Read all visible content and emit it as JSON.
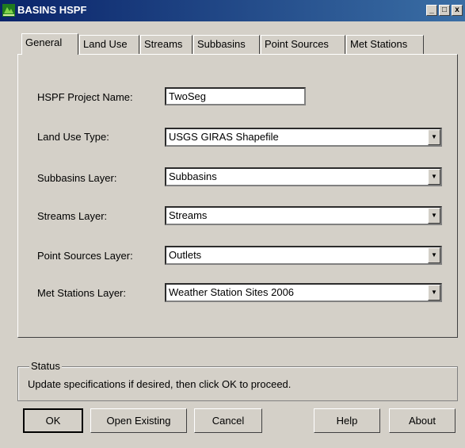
{
  "window": {
    "title": "BASINS HSPF"
  },
  "titlebar_buttons": {
    "minimize": "_",
    "maximize": "□",
    "close": "x"
  },
  "tabs": [
    "General",
    "Land Use",
    "Streams",
    "Subbasins",
    "Point Sources",
    "Met Stations"
  ],
  "active_tab": "General",
  "form": {
    "project_name": {
      "label": "HSPF Project Name:",
      "value": "TwoSeg"
    },
    "land_use_type": {
      "label": "Land Use Type:",
      "value": "USGS GIRAS Shapefile"
    },
    "subbasins_layer": {
      "label": "Subbasins Layer:",
      "value": "Subbasins"
    },
    "streams_layer": {
      "label": "Streams Layer:",
      "value": "Streams"
    },
    "point_sources_layer": {
      "label": "Point Sources Layer:",
      "value": "Outlets"
    },
    "met_stations_layer": {
      "label": "Met Stations Layer:",
      "value": "Weather Station Sites 2006"
    }
  },
  "status": {
    "caption": "Status",
    "message": "Update specifications if desired, then click OK to proceed."
  },
  "buttons": {
    "ok": "OK",
    "open_existing": "Open Existing",
    "cancel": "Cancel",
    "help": "Help",
    "about": "About"
  },
  "colors": {
    "dialog_bg": "#d4d0c8",
    "titlebar_start": "#0a246a",
    "titlebar_end": "#3a6ea5"
  }
}
